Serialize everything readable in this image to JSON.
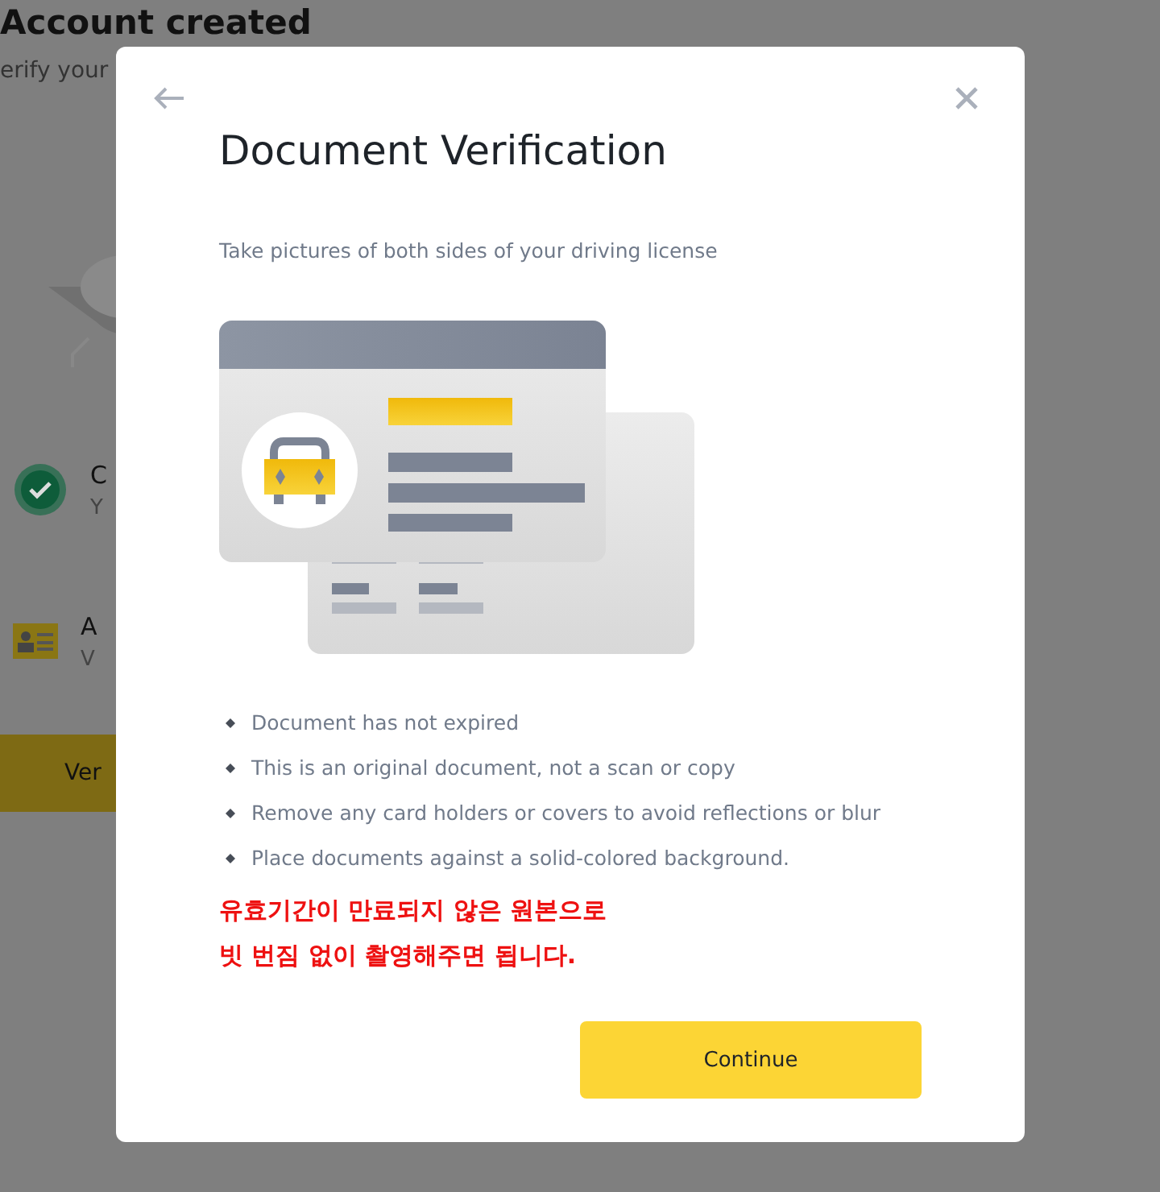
{
  "background": {
    "title": "Account created",
    "subtitle": "erify your",
    "items": [
      {
        "kind": "check",
        "title": "C",
        "subtitle": "Y"
      },
      {
        "kind": "id-card",
        "title": "A",
        "subtitle": "V"
      }
    ],
    "button": "Ver"
  },
  "dialog": {
    "title": "Document Verification",
    "instruction": "Take pictures of both sides of your driving license",
    "tips": [
      "Document has not expired",
      "This is an original document, not a scan or copy",
      "Remove any card holders or covers to avoid reflections or blur",
      "Place documents against a solid-colored background."
    ],
    "notes": [
      "유효기간이 만료되지 않은 원본으로",
      "빗 번짐 없이 촬영해주면 됩니다."
    ],
    "button": "Continue"
  }
}
